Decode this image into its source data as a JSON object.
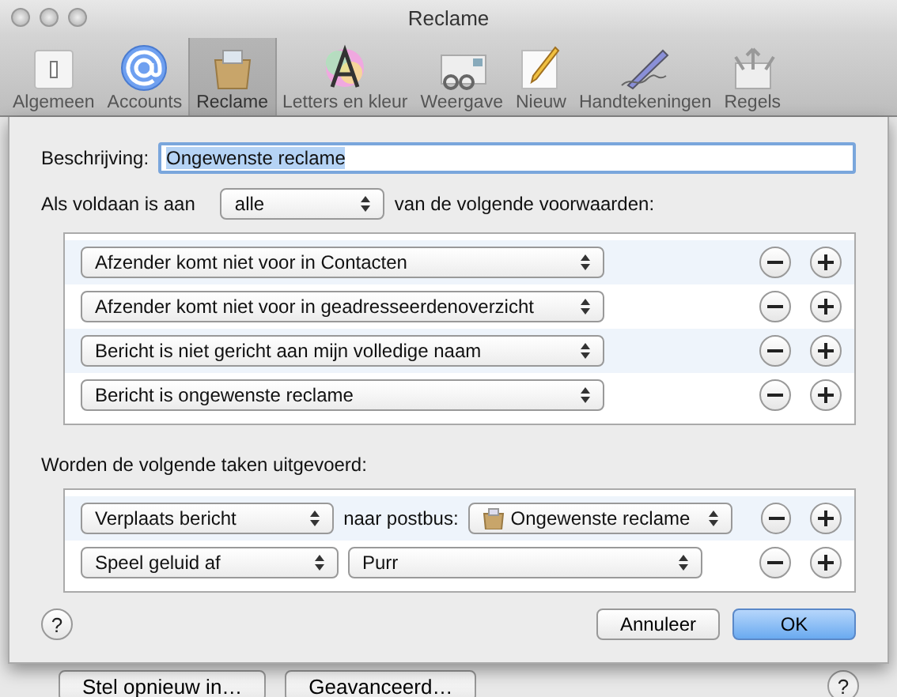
{
  "window": {
    "title": "Reclame"
  },
  "toolbar": [
    {
      "label": "Algemeen",
      "selected": false
    },
    {
      "label": "Accounts",
      "selected": false
    },
    {
      "label": "Reclame",
      "selected": true
    },
    {
      "label": "Letters en kleur",
      "selected": false
    },
    {
      "label": "Weergave",
      "selected": false
    },
    {
      "label": "Nieuw",
      "selected": false
    },
    {
      "label": "Handtekeningen",
      "selected": false
    },
    {
      "label": "Regels",
      "selected": false
    }
  ],
  "sheet": {
    "description": {
      "label": "Beschrijving:",
      "value": "Ongewenste reclame",
      "text_selected": true
    },
    "match": {
      "prefix": "Als voldaan is aan",
      "value": "alle",
      "suffix": "van de volgende voorwaarden:"
    },
    "conditions": [
      {
        "value": "Afzender komt niet voor in Contacten"
      },
      {
        "value": "Afzender komt niet voor in geadresseerdenoverzicht"
      },
      {
        "value": "Bericht is niet gericht aan mijn volledige naam"
      },
      {
        "value": "Bericht is ongewenste reclame"
      }
    ],
    "actions_label": "Worden de volgende taken uitgevoerd:",
    "actions": [
      {
        "kind": "mailbox",
        "action": "Verplaats bericht",
        "connector": "naar postbus:",
        "target": "Ongewenste reclame"
      },
      {
        "kind": "sound",
        "action": "Speel geluid af",
        "target": "Purr"
      }
    ],
    "help": "?",
    "buttons": [
      {
        "label": "Annuleer",
        "default": false
      },
      {
        "label": "OK",
        "default": true
      }
    ]
  },
  "background": {
    "buttons": [
      "Stel opnieuw in…",
      "Geavanceerd…"
    ],
    "help": "?"
  }
}
